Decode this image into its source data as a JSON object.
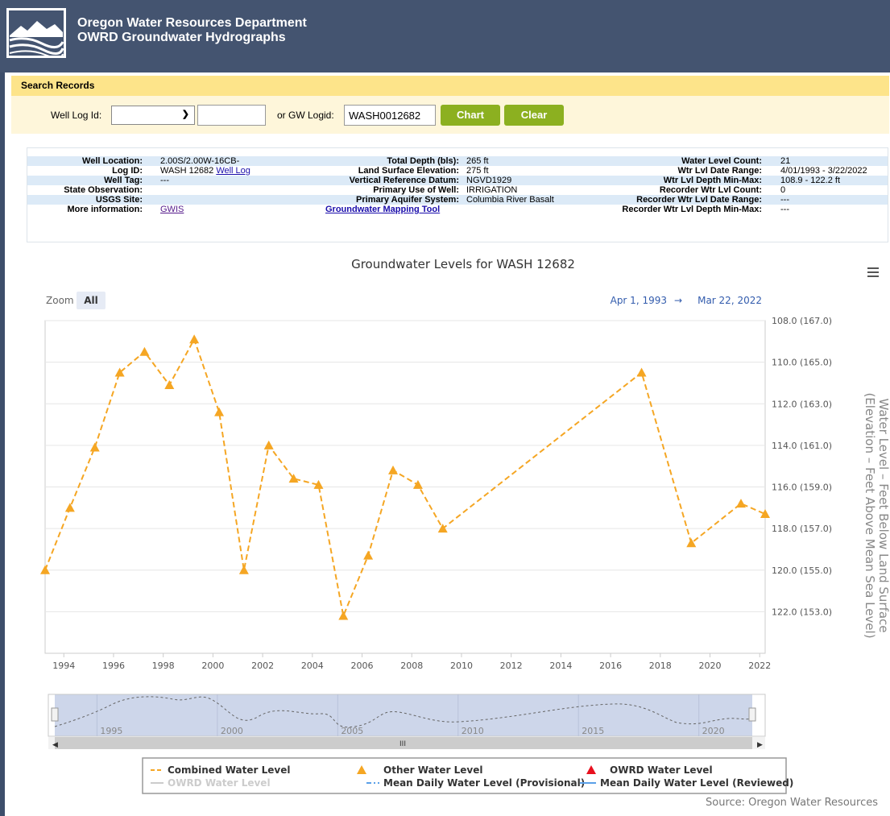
{
  "header": {
    "line1": "Oregon Water Resources Department",
    "line2": "OWRD Groundwater Hydrographs"
  },
  "search": {
    "title": "Search Records",
    "well_log_label": "Well Log Id:",
    "well_log_select_value": "",
    "well_log_number_value": "",
    "gw_logid_label": "or GW Logid:",
    "gw_logid_value": "WASH0012682",
    "chart_button": "Chart",
    "clear_button": "Clear"
  },
  "info": {
    "col1": [
      {
        "label": "Well Location:",
        "value": "2.00S/2.00W-16CB-"
      },
      {
        "label": "Log ID:",
        "value": "WASH 12682",
        "link": "Well Log"
      },
      {
        "label": "Well Tag:",
        "value": "---"
      },
      {
        "label": "State Observation:",
        "value": ""
      },
      {
        "label": "USGS Site:",
        "value": ""
      },
      {
        "label": "More information:",
        "value": "",
        "link": "GWIS"
      }
    ],
    "col2": [
      {
        "label": "Total Depth (bls):",
        "value": "265 ft"
      },
      {
        "label": "Land Surface Elevation:",
        "value": "275 ft"
      },
      {
        "label": "Vertical Reference Datum:",
        "value": "NGVD1929"
      },
      {
        "label": "Primary Use of Well:",
        "value": "IRRIGATION"
      },
      {
        "label": "Primary Aquifer System:",
        "value": "Columbia River Basalt"
      },
      {
        "label": "",
        "value": "",
        "link": "Groundwater Mapping Tool"
      }
    ],
    "col3": [
      {
        "label": "Water Level Count:",
        "value": "21"
      },
      {
        "label": "Wtr Lvl Date Range:",
        "value": "4/01/1993 - 3/22/2022"
      },
      {
        "label": "Wtr Lvl Depth Min-Max:",
        "value": "108.9 - 122.2 ft"
      },
      {
        "label": "Recorder Wtr Lvl Count:",
        "value": "0"
      },
      {
        "label": "Recorder Wtr Lvl Date Range:",
        "value": "---"
      },
      {
        "label": "Recorder Wtr Lvl Depth Min-Max:",
        "value": "---"
      }
    ]
  },
  "zoom": {
    "label": "Zoom",
    "all": "All"
  },
  "range_display": {
    "from": "Apr 1, 1993",
    "arrow": "→",
    "to": "Mar 22, 2022"
  },
  "source": "Source: Oregon Water Resources",
  "colors": {
    "series": "#f5a623",
    "grid": "#e6e6e6",
    "navigator_fill": "#cdd6ea",
    "legend_red": "#e8101e",
    "legend_blue": "#5aa0e8"
  },
  "icons": [
    "menu-icon",
    "logo-icon"
  ],
  "chart_data": {
    "type": "line",
    "title": "Groundwater Levels for WASH 12682",
    "ylabel_line1": "Water Level – Feet Below Land Surface",
    "ylabel_line2": "(Elevation – Feet Above Mean Sea Level)",
    "x_ticks": [
      "1994",
      "1996",
      "1998",
      "2000",
      "2002",
      "2004",
      "2006",
      "2008",
      "2010",
      "2012",
      "2014",
      "2016",
      "2018",
      "2020",
      "2022"
    ],
    "y_ticks": [
      {
        "value": 108,
        "label": "108.0 (167.0)"
      },
      {
        "value": 110,
        "label": "110.0 (165.0)"
      },
      {
        "value": 112,
        "label": "112.0 (163.0)"
      },
      {
        "value": 114,
        "label": "114.0 (161.0)"
      },
      {
        "value": 116,
        "label": "116.0 (159.0)"
      },
      {
        "value": 118,
        "label": "118.0 (157.0)"
      },
      {
        "value": 120,
        "label": "120.0 (155.0)"
      },
      {
        "value": 122,
        "label": "122.0 (153.0)"
      }
    ],
    "xlim": [
      "1993-04-01",
      "2022-03-22"
    ],
    "ylim": [
      108,
      124
    ],
    "y_reversed": true,
    "series": [
      {
        "name": "Combined Water Level",
        "style": "dashed-triangles",
        "points": [
          {
            "date": "1993-04-01",
            "y": 120.0
          },
          {
            "date": "1994-04-01",
            "y": 117.0
          },
          {
            "date": "1995-04-01",
            "y": 114.1
          },
          {
            "date": "1996-04-01",
            "y": 110.5
          },
          {
            "date": "1997-04-01",
            "y": 109.5
          },
          {
            "date": "1998-04-01",
            "y": 111.1
          },
          {
            "date": "1999-04-01",
            "y": 108.9
          },
          {
            "date": "2000-04-01",
            "y": 112.4
          },
          {
            "date": "2001-04-01",
            "y": 120.0
          },
          {
            "date": "2002-04-01",
            "y": 114.0
          },
          {
            "date": "2003-04-01",
            "y": 115.6
          },
          {
            "date": "2004-04-01",
            "y": 115.9
          },
          {
            "date": "2005-04-01",
            "y": 122.2
          },
          {
            "date": "2006-04-01",
            "y": 119.3
          },
          {
            "date": "2007-04-01",
            "y": 115.2
          },
          {
            "date": "2008-04-01",
            "y": 115.9
          },
          {
            "date": "2009-04-01",
            "y": 118.0
          },
          {
            "date": "2017-04-01",
            "y": 110.5
          },
          {
            "date": "2019-04-01",
            "y": 118.7
          },
          {
            "date": "2021-04-01",
            "y": 116.8
          },
          {
            "date": "2022-03-22",
            "y": 117.3
          }
        ]
      }
    ],
    "navigator_ticks": [
      "1995",
      "2000",
      "2005",
      "2010",
      "2015",
      "2020"
    ],
    "legend": [
      {
        "label": "Combined Water Level",
        "symbol": "dash-orange"
      },
      {
        "label": "Other Water Level",
        "symbol": "triangle-orange"
      },
      {
        "label": "OWRD Water Level",
        "symbol": "triangle-red"
      },
      {
        "label": "OWRD Water Level",
        "symbol": "line-gray",
        "disabled": true
      },
      {
        "label": "Mean Daily Water Level (Provisional)",
        "symbol": "dashdot-blue"
      },
      {
        "label": "Mean Daily Water Level (Reviewed)",
        "symbol": "line-blue"
      }
    ]
  }
}
